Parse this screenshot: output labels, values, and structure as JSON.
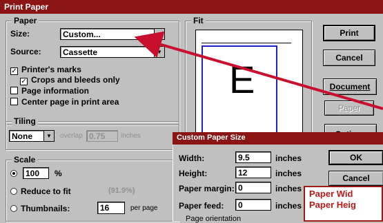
{
  "window": {
    "title": "Print Paper"
  },
  "paper": {
    "group_label": "Paper",
    "size_label": "Size:",
    "size_value": "Custom...",
    "source_label": "Source:",
    "source_value": "Cassette",
    "printers_marks": "Printer's marks",
    "crops_only": "Crops and bleeds only",
    "page_information": "Page information",
    "center_page": "Center page in print area"
  },
  "tiling": {
    "group_label": "Tiling",
    "mode_value": "None",
    "overlap_label": "overlap",
    "overlap_value": "0.75",
    "overlap_unit": "inches"
  },
  "scale": {
    "group_label": "Scale",
    "percent_value": "100",
    "percent_sign": "%",
    "reduce_label": "Reduce to fit",
    "reduce_value": "(91.9%)",
    "thumbnails_label": "Thumbnails:",
    "thumbnails_value": "16",
    "per_page": "per page"
  },
  "fit": {
    "group_label": "Fit",
    "preview_letter": "E"
  },
  "buttons": {
    "print": "Print",
    "cancel": "Cancel",
    "document": "Document",
    "paper": "Paper",
    "options": "Options"
  },
  "custom_size": {
    "title": "Custom Paper Size",
    "width_label": "Width:",
    "width_value": "9.5",
    "height_label": "Height:",
    "height_value": "12",
    "margin_label": "Paper margin:",
    "margin_value": "0",
    "feed_label": "Paper feed:",
    "feed_value": "0",
    "unit": "inches",
    "orientation_label": "Page orientation",
    "ok": "OK",
    "cancel": "Cancel"
  },
  "callout": {
    "line1": "Paper Wid",
    "line2": "Paper Heig"
  },
  "colors": {
    "titlebar": "#8b1414",
    "arrow": "#c8102e",
    "preview_border": "#2020d0"
  }
}
